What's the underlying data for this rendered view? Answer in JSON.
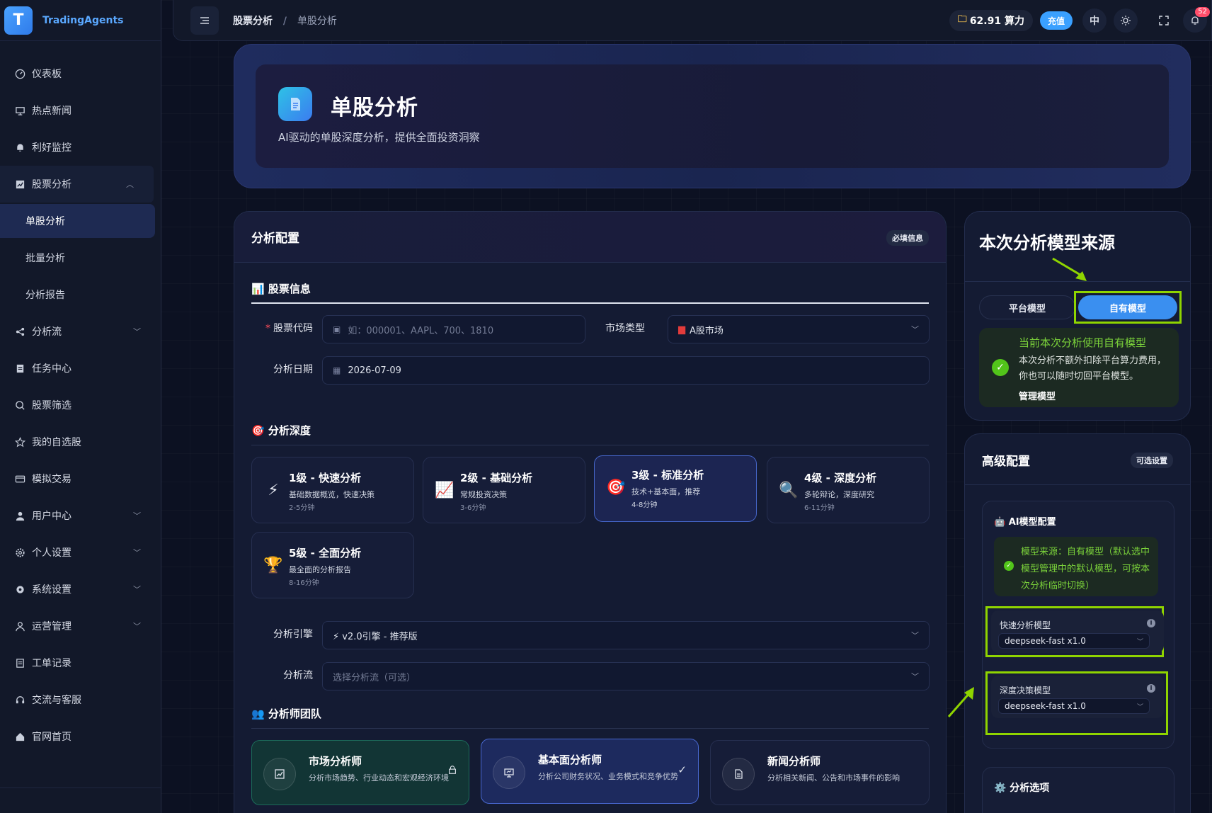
{
  "brand": {
    "logo_letter": "T",
    "name": "TradingAgents"
  },
  "sidebar": {
    "items": [
      {
        "label": "仪表板",
        "icon": "dashboard-icon"
      },
      {
        "label": "热点新闻",
        "icon": "news-icon"
      },
      {
        "label": "利好监控",
        "icon": "bell-icon"
      },
      {
        "label": "股票分析",
        "icon": "chart-icon",
        "expanded": true
      },
      {
        "label": "单股分析",
        "sub": true,
        "active": true
      },
      {
        "label": "批量分析",
        "sub": true
      },
      {
        "label": "分析报告",
        "sub": true
      },
      {
        "label": "分析流",
        "icon": "share-icon"
      },
      {
        "label": "任务中心",
        "icon": "clipboard-icon"
      },
      {
        "label": "股票筛选",
        "icon": "search-icon"
      },
      {
        "label": "我的自选股",
        "icon": "star-icon"
      },
      {
        "label": "模拟交易",
        "icon": "card-icon"
      },
      {
        "label": "用户中心",
        "icon": "user-icon"
      },
      {
        "label": "个人设置",
        "icon": "gear-icon"
      },
      {
        "label": "系统设置",
        "icon": "settings-icon"
      },
      {
        "label": "运营管理",
        "icon": "admin-icon"
      },
      {
        "label": "工单记录",
        "icon": "ticket-icon"
      },
      {
        "label": "交流与客服",
        "icon": "headset-icon"
      },
      {
        "label": "官网首页",
        "icon": "home-icon"
      }
    ]
  },
  "topbar": {
    "breadcrumb_root": "股票分析",
    "breadcrumb_sep": "/",
    "breadcrumb_current": "单股分析",
    "credits": "62.91 算力",
    "recharge": "充值",
    "lang": "中",
    "notif_count": "52"
  },
  "hero": {
    "title": "单股分析",
    "subtitle": "AI驱动的单股深度分析，提供全面投资洞察"
  },
  "config": {
    "title": "分析配置",
    "required_badge": "必填信息",
    "stock_section": "📊 股票信息",
    "code_label": "股票代码",
    "code_placeholder": "如：000001、AAPL、700、1810",
    "market_label": "市场类型",
    "market_value": "A股市场",
    "date_label": "分析日期",
    "date_value": "2026-07-09",
    "depth_section": "🎯 分析深度",
    "levels": [
      {
        "icon": "⚡",
        "title": "1级 - 快速分析",
        "desc": "基础数据概览，快速决策",
        "time": "2-5分钟"
      },
      {
        "icon": "📈",
        "title": "2级 - 基础分析",
        "desc": "常规投资决策",
        "time": "3-6分钟"
      },
      {
        "icon": "🎯",
        "title": "3级 - 标准分析",
        "desc": "技术+基本面，推荐",
        "time": "4-8分钟",
        "selected": true
      },
      {
        "icon": "🔍",
        "title": "4级 - 深度分析",
        "desc": "多轮辩论，深度研究",
        "time": "6-11分钟"
      },
      {
        "icon": "🏆",
        "title": "5级 - 全面分析",
        "desc": "最全面的分析报告",
        "time": "8-16分钟"
      }
    ],
    "engine_label": "分析引擎",
    "engine_value": "⚡ v2.0引擎 - 推荐版",
    "flow_label": "分析流",
    "flow_placeholder": "选择分析流（可选）",
    "team_section": "👥 分析师团队",
    "analysts": [
      {
        "title": "市场分析师",
        "desc": "分析市场趋势、行业动态和宏观经济环境"
      },
      {
        "title": "基本面分析师",
        "desc": "分析公司财务状况、业务模式和竞争优势"
      },
      {
        "title": "新闻分析师",
        "desc": "分析相关新闻、公告和市场事件的影响"
      }
    ]
  },
  "model_source": {
    "title": "本次分析模型来源",
    "platform": "平台模型",
    "own": "自有模型",
    "info_title": "当前本次分析使用自有模型",
    "info_text": "本次分析不额外扣除平台算力费用，你也可以随时切回平台模型。",
    "manage": "管理模型"
  },
  "advanced": {
    "title": "高级配置",
    "badge": "可选设置",
    "ai_title": "🤖 AI模型配置",
    "source_text": "模型来源：自有模型（默认选中模型管理中的默认模型，可按本次分析临时切换）",
    "fast_label": "快速分析模型",
    "fast_value": "deepseek-fast x1.0",
    "deep_label": "深度决策模型",
    "deep_value": "deepseek-fast x1.0",
    "options_title": "⚙️ 分析选项"
  },
  "colors": {
    "accent": "#3a8ff0",
    "highlight": "#8fd400",
    "success": "#52c41a"
  }
}
